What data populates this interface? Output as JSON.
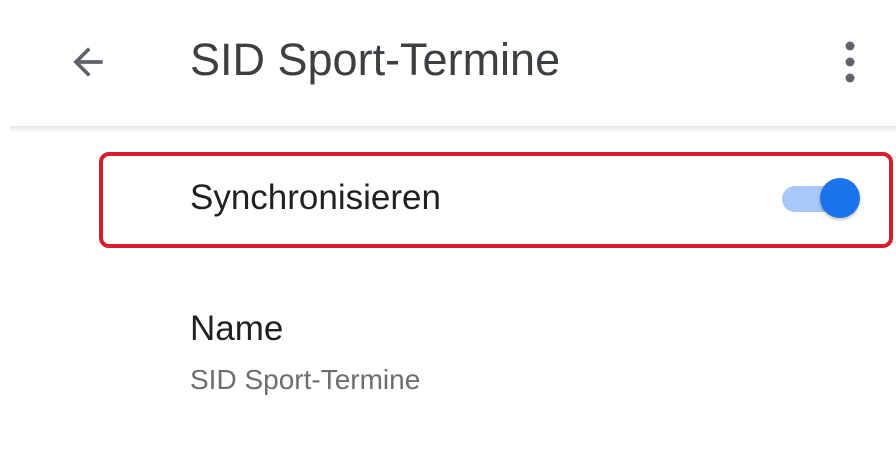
{
  "header": {
    "title": "SID Sport-Termine",
    "back_icon": "arrow-left-icon",
    "more_icon": "more-vert-icon"
  },
  "settings": {
    "sync": {
      "label": "Synchronisieren",
      "enabled": true,
      "highlight_color": "#d3202c",
      "toggle_color": "#1a73e8"
    },
    "name": {
      "label": "Name",
      "value": "SID Sport-Termine"
    }
  }
}
